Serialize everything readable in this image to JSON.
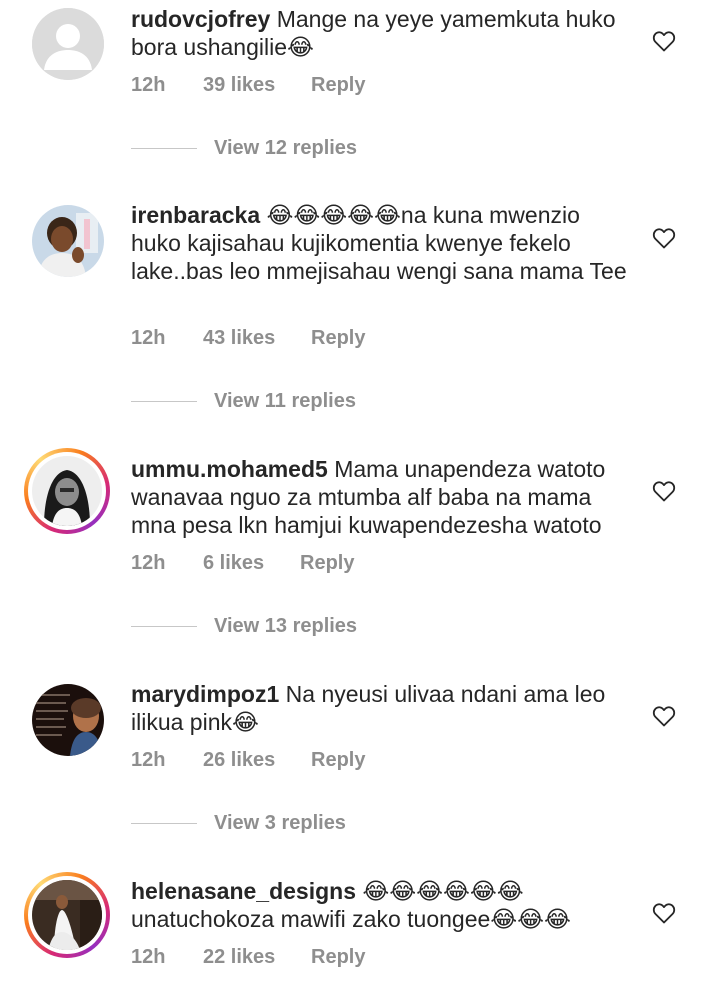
{
  "comments": [
    {
      "username": "rudovcjofrey",
      "text": "Mange na yeye yamemkuta huko bora ushangilie😂",
      "time": "12h",
      "likes": "39 likes",
      "reply": "Reply",
      "view_replies": "View 12 replies",
      "avatar": "default-avatar",
      "story_ring": false
    },
    {
      "username": "irenbaracka",
      "text": "😂😂😂😂😂na kuna mwenzio huko kajisahau kujikomentia kwenye fekelo lake..bas leo mmejisahau wengi sana mama Tee",
      "time": "12h",
      "likes": "43 likes",
      "reply": "Reply",
      "view_replies": "View 11 replies",
      "avatar": "photo-avatar",
      "story_ring": false
    },
    {
      "username": "ummu.mohamed5",
      "text": "Mama unapendeza watoto wanavaa nguo za mtumba alf baba na mama mna pesa lkn hamjui kuwapendezesha watoto",
      "time": "12h",
      "likes": "6 likes",
      "reply": "Reply",
      "view_replies": "View 13 replies",
      "avatar": "photo-avatar",
      "story_ring": true
    },
    {
      "username": "marydimpoz1",
      "text": "Na nyeusi ulivaa ndani ama leo ilikua pink😂",
      "time": "12h",
      "likes": "26 likes",
      "reply": "Reply",
      "view_replies": "View 3 replies",
      "avatar": "photo-avatar",
      "story_ring": false
    },
    {
      "username": "helenasane_designs",
      "text": "😂😂😂😂😂😂 unatuchokoza mawifi zako tuongee😂😂😂",
      "time": "12h",
      "likes": "22 likes",
      "reply": "Reply",
      "view_replies": "",
      "avatar": "photo-avatar",
      "story_ring": true
    }
  ],
  "colors": {
    "text": "#262626",
    "secondary": "#8e8e8e",
    "divider": "#c7c7c7"
  },
  "icons": {
    "like": "heart-outline-icon",
    "emoji": "face-with-tears-of-joy-emoji"
  }
}
